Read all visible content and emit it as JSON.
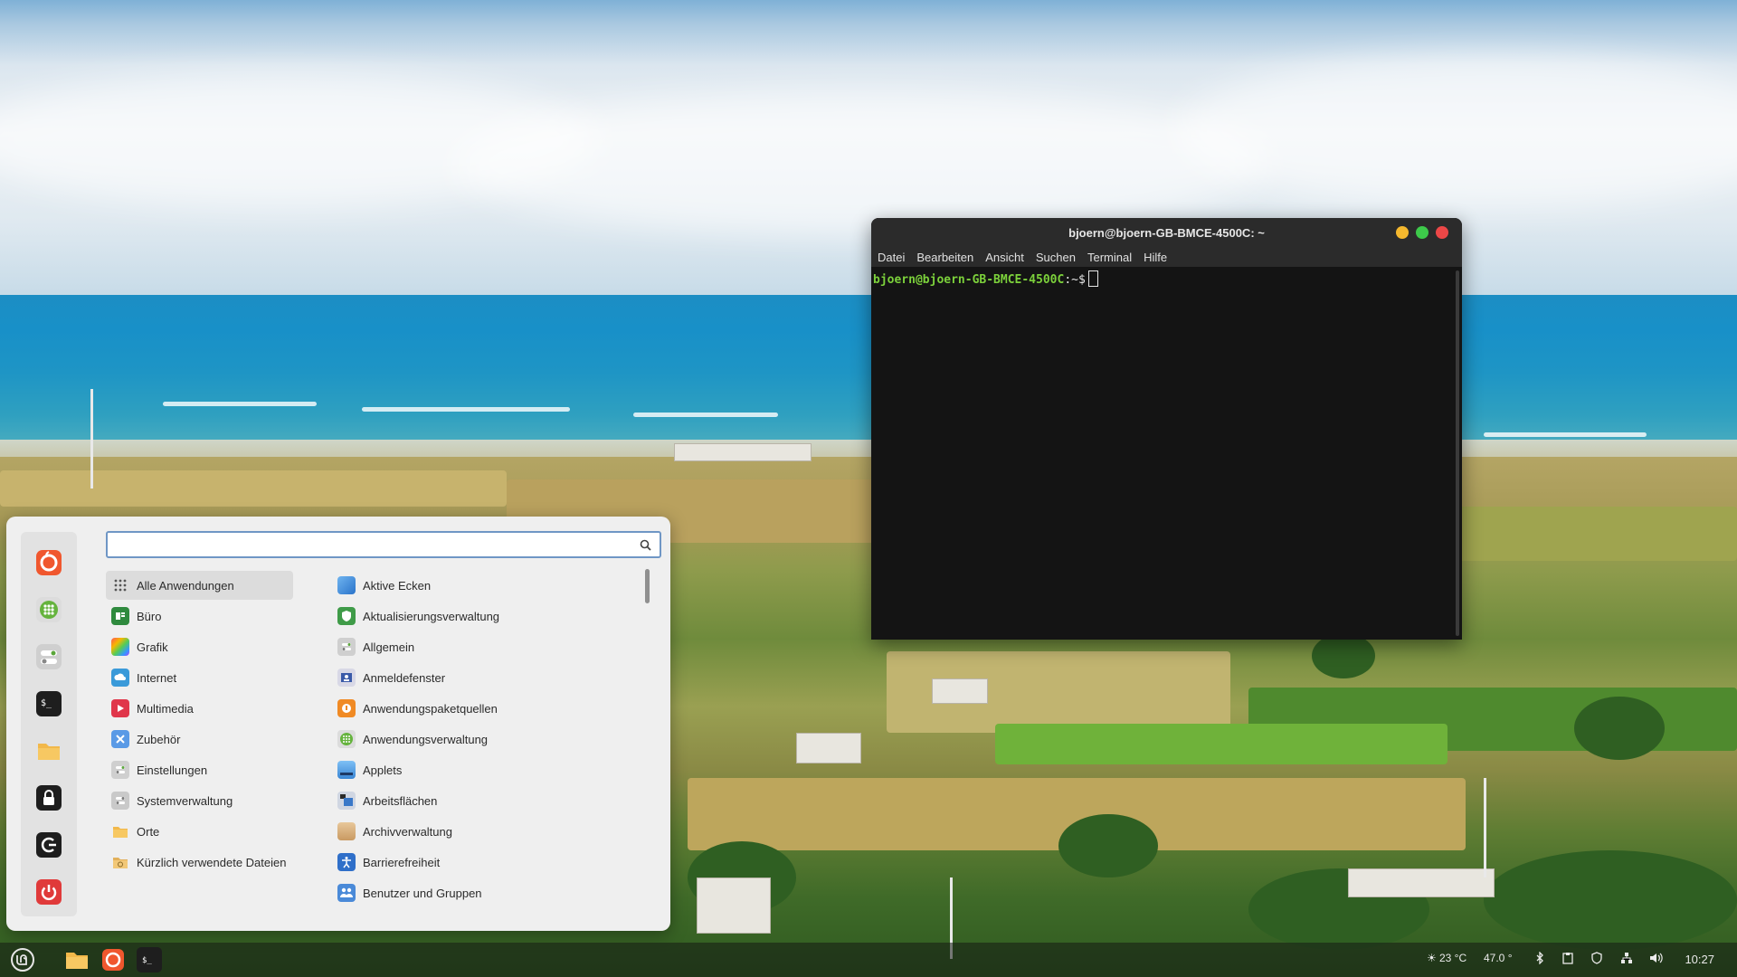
{
  "terminal": {
    "title": "bjoern@bjoern-GB-BMCE-4500C: ~",
    "menu": [
      "Datei",
      "Bearbeiten",
      "Ansicht",
      "Suchen",
      "Terminal",
      "Hilfe"
    ],
    "prompt_user": "bjoern@bjoern-GB-BMCE-4500C",
    "prompt_path": ":~$"
  },
  "menu": {
    "search_value": "",
    "favorites": [
      "firefox-icon",
      "software-manager-icon",
      "settings-toggle-icon",
      "terminal-icon",
      "folder-icon",
      "lock-icon",
      "logout-icon",
      "power-icon"
    ],
    "categories": [
      {
        "label": "Alle Anwendungen",
        "icon": "grid-icon",
        "active": true
      },
      {
        "label": "Büro",
        "icon": "office-icon"
      },
      {
        "label": "Grafik",
        "icon": "graphics-icon"
      },
      {
        "label": "Internet",
        "icon": "internet-icon"
      },
      {
        "label": "Multimedia",
        "icon": "multimedia-icon"
      },
      {
        "label": "Zubehör",
        "icon": "accessories-icon"
      },
      {
        "label": "Einstellungen",
        "icon": "settings-icon"
      },
      {
        "label": "Systemverwaltung",
        "icon": "system-icon"
      },
      {
        "label": "Orte",
        "icon": "folder-icon"
      },
      {
        "label": "Kürzlich verwendete Dateien",
        "icon": "recent-files-icon"
      }
    ],
    "apps": [
      {
        "label": "Aktive Ecken",
        "icon": "hot-corners-icon"
      },
      {
        "label": "Aktualisierungsverwaltung",
        "icon": "update-shield-icon"
      },
      {
        "label": "Allgemein",
        "icon": "general-settings-icon"
      },
      {
        "label": "Anmeldefenster",
        "icon": "login-window-icon"
      },
      {
        "label": "Anwendungspaketquellen",
        "icon": "software-sources-icon"
      },
      {
        "label": "Anwendungsverwaltung",
        "icon": "software-manager-icon"
      },
      {
        "label": "Applets",
        "icon": "applets-icon"
      },
      {
        "label": "Arbeitsflächen",
        "icon": "workspaces-icon"
      },
      {
        "label": "Archivverwaltung",
        "icon": "archive-icon"
      },
      {
        "label": "Barrierefreiheit",
        "icon": "accessibility-icon"
      },
      {
        "label": "Benutzer und Gruppen",
        "icon": "users-groups-icon"
      }
    ]
  },
  "panel": {
    "launchers": [
      "menu-icon",
      "files-icon",
      "firefox-icon",
      "terminal-icon"
    ],
    "temperature": "23 °C",
    "cpu_temp": "47.0 °",
    "clock": "10:27"
  },
  "colors": {
    "accent_green": "#7cd13b",
    "menu_bg": "#efefef",
    "search_border": "#6f96c5"
  }
}
